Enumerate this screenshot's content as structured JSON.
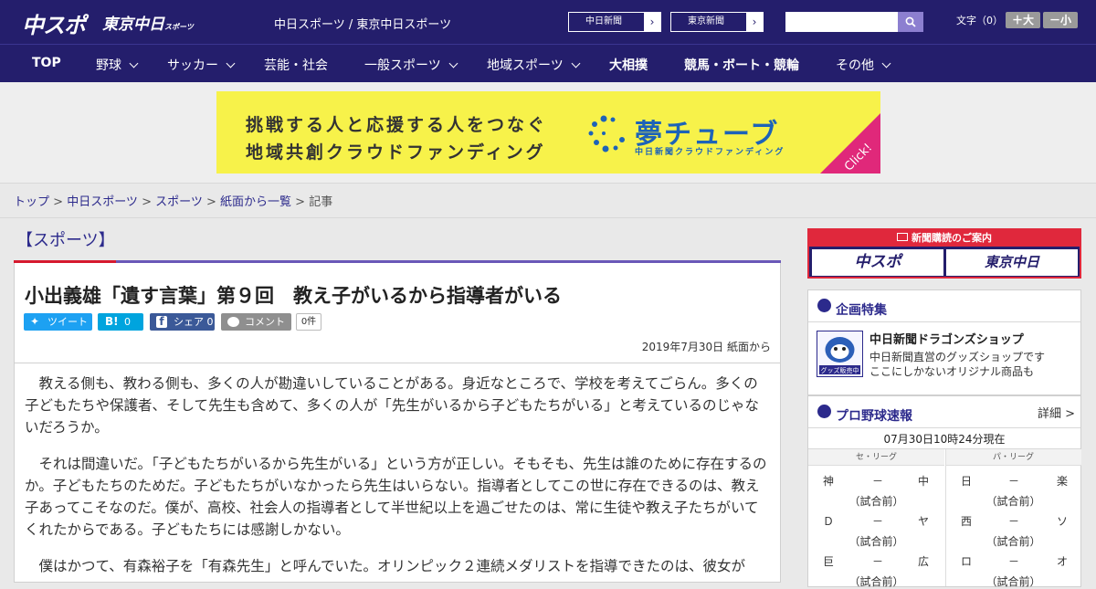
{
  "header": {
    "logo_chuspo": "中スポ",
    "logo_tokyo": "東京中日",
    "logo_tokyo_suffix": "スポーツ",
    "site_names": "中日スポーツ / 東京中日スポーツ",
    "chunichi_label": "中日新聞",
    "tokyo_label": "東京新聞",
    "search_placeholder": "",
    "font_size_label": "文字（0）",
    "font_larger": "＋大",
    "font_smaller": "－小"
  },
  "nav": [
    "TOP",
    "野球",
    "サッカー",
    "芸能・社会",
    "一般スポーツ",
    "地域スポーツ",
    "大相撲",
    "競馬・ボート・競輪",
    "その他"
  ],
  "banner": {
    "line1": "挑戦する人と応援する人をつなぐ",
    "line2": "地域共創クラウドファンディング",
    "brand": "夢チューブ",
    "brand_sub": "中日新聞クラウドファンディング",
    "click": "Click!"
  },
  "breadcrumb": {
    "top": "トップ",
    "chuspo": "中日スポーツ",
    "sports": "スポーツ",
    "paper": "紙面から一覧",
    "current": "記事",
    "sep": " > "
  },
  "article": {
    "section": "【スポーツ】",
    "title": "小出義雄「遺す言葉」第９回　教え子がいるから指導者がいる",
    "tweet": "ツイート",
    "hatena_count": "0",
    "share": "シェア",
    "share_count": "0",
    "comment": "コメント",
    "comment_count": "0件",
    "date": "2019年7月30日 紙面から",
    "paragraphs": [
      "教える側も、教わる側も、多くの人が勘違いしていることがある。身近なところで、学校を考えてごらん。多くの子どもたちや保護者、そして先生も含めて、多くの人が「先生がいるから子どもたちがいる」と考えているのじゃないだろうか。",
      "それは間違いだ。「子どもたちがいるから先生がいる」という方が正しい。そもそも、先生は誰のために存在するのか。子どもたちのためだ。子どもたちがいなかったら先生はいらない。指導者としてこの世に存在できるのは、教え子あってこそなのだ。僕が、高校、社会人の指導者として半世紀以上を過ごせたのは、常に生徒や教え子たちがいてくれたからである。子どもたちには感謝しかない。",
      "僕はかつて、有森裕子を「有森先生」と呼んでいた。オリンピック２連続メダリストを指導できたのは、彼女が"
    ]
  },
  "sidebar": {
    "subscribe_head": "新聞購読のご案内",
    "sub_chuspo": "中スポ",
    "sub_tokyo": "東京中日",
    "special_title": "企画特集",
    "shop_badge": "グッズ販売中",
    "shop_title": "中日新聞ドラゴンズショップ",
    "shop_desc1": "中日新聞直営のグッズショップです",
    "shop_desc2": "ここにしかないオリジナル商品も",
    "baseball_title": "プロ野球速報",
    "detail_link": "詳細 >",
    "updated": "07月30日10時24分現在",
    "central": "セ・リーグ",
    "pacific": "パ・リーグ",
    "games": [
      {
        "home": "神",
        "dash": "－",
        "away": "中",
        "status": "（試合前）"
      },
      {
        "home": "日",
        "dash": "－",
        "away": "楽",
        "status": "（試合前）"
      },
      {
        "home": "Ｄ",
        "dash": "－",
        "away": "ヤ",
        "status": "（試合前）"
      },
      {
        "home": "西",
        "dash": "－",
        "away": "ソ",
        "status": "（試合前）"
      },
      {
        "home": "巨",
        "dash": "－",
        "away": "広",
        "status": "（試合前）"
      },
      {
        "home": "ロ",
        "dash": "－",
        "away": "オ",
        "status": "（試合前）"
      }
    ]
  },
  "colors": {
    "brand_navy": "#241e6c",
    "accent_red": "#d61a2f",
    "accent_purple": "#6a58b8",
    "banner_yellow": "#f7f24a",
    "twitter": "#1da1f2",
    "hatena": "#00a4de",
    "facebook": "#3b5998",
    "comment": "#8f8f8f"
  }
}
